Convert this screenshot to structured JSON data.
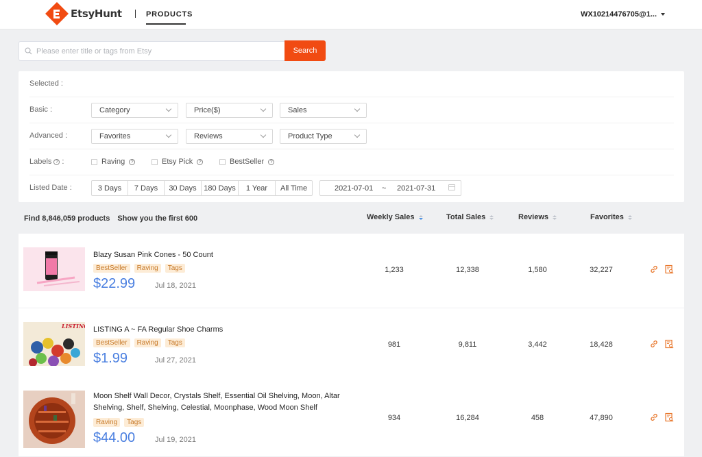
{
  "header": {
    "logo_text": "EtsyHunt",
    "nav_products": "PRODUCTS",
    "account": "WX10214476705@1..."
  },
  "search": {
    "placeholder": "Please enter title or tags from Etsy",
    "button_label": "Search"
  },
  "filters": {
    "selected_label": "Selected :",
    "basic_label": "Basic :",
    "basic_options": [
      "Category",
      "Price($)",
      "Sales"
    ],
    "advanced_label": "Advanced :",
    "advanced_options": [
      "Favorites",
      "Reviews",
      "Product Type"
    ],
    "labels_label": "Labels",
    "label_checkboxes": [
      "Raving",
      "Etsy Pick",
      "BestSeller"
    ],
    "listed_date_label": "Listed Date :",
    "date_presets": [
      "3 Days",
      "7 Days",
      "30 Days",
      "180 Days",
      "1 Year",
      "All Time"
    ],
    "date_start": "2021-07-01",
    "date_sep": "~",
    "date_end": "2021-07-31"
  },
  "results": {
    "count_text": "Find 8,846,059 products",
    "showing_text": "Show you the first 600",
    "columns": [
      "Weekly Sales",
      "Total Sales",
      "Reviews",
      "Favorites"
    ]
  },
  "products": [
    {
      "title": "Blazy Susan Pink Cones - 50 Count",
      "tags": [
        "BestSeller",
        "Raving",
        "Tags"
      ],
      "price": "$22.99",
      "date": "Jul 18, 2021",
      "weekly_sales": "1,233",
      "total_sales": "12,338",
      "reviews": "1,580",
      "favorites": "32,227"
    },
    {
      "title": "LISTING A ~ FA Regular Shoe Charms",
      "thumb_text": "LISTING A-FA",
      "tags": [
        "BestSeller",
        "Raving",
        "Tags"
      ],
      "price": "$1.99",
      "date": "Jul 27, 2021",
      "weekly_sales": "981",
      "total_sales": "9,811",
      "reviews": "3,442",
      "favorites": "18,428"
    },
    {
      "title": "Moon Shelf Wall Decor, Crystals Shelf, Essential Oil Shelving, Moon, Altar Shelving, Shelf, Shelving, Celestial, Moonphase, Wood Moon Shelf",
      "tags": [
        "Raving",
        "Tags"
      ],
      "price": "$44.00",
      "date": "Jul 19, 2021",
      "weekly_sales": "934",
      "total_sales": "16,284",
      "reviews": "458",
      "favorites": "47,890"
    }
  ],
  "colors": {
    "accent": "#f14b12",
    "price": "#4a7fe0",
    "tag_bg": "#fdecd6",
    "tag_text": "#c77a2a"
  }
}
